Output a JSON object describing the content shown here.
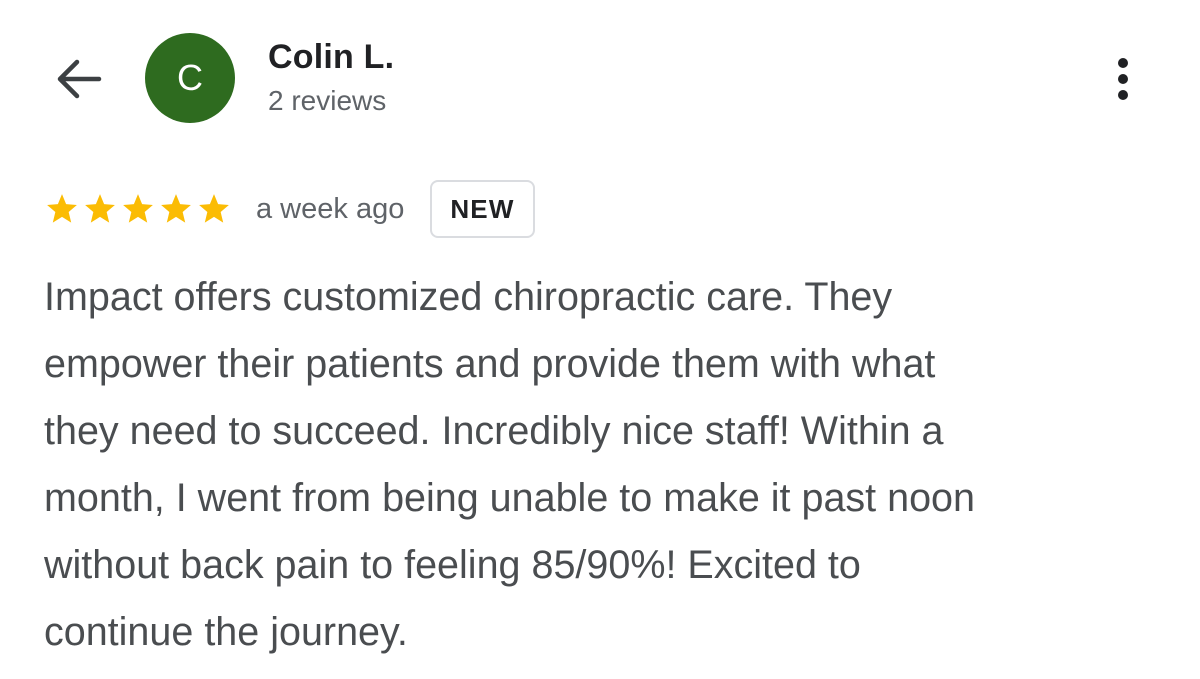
{
  "header": {
    "back_icon": "arrow-left-icon",
    "avatar_letter": "C",
    "avatar_color": "#2e6b1f",
    "reviewer_name": "Colin L.",
    "review_count": "2 reviews",
    "more_icon": "more-vert-icon"
  },
  "review": {
    "rating": 5,
    "rating_max": 5,
    "star_color": "#fbbc04",
    "time": "a week ago",
    "badge": "NEW",
    "text_lines": [
      "Impact offers customized chiropractic care. They",
      "empower their patients and provide them with what",
      "they need to succeed. Incredibly nice staff! Within a",
      "month, I went from being unable to make it past noon",
      "without back pain to feeling 85/90%! Excited to",
      "continue the journey."
    ]
  }
}
